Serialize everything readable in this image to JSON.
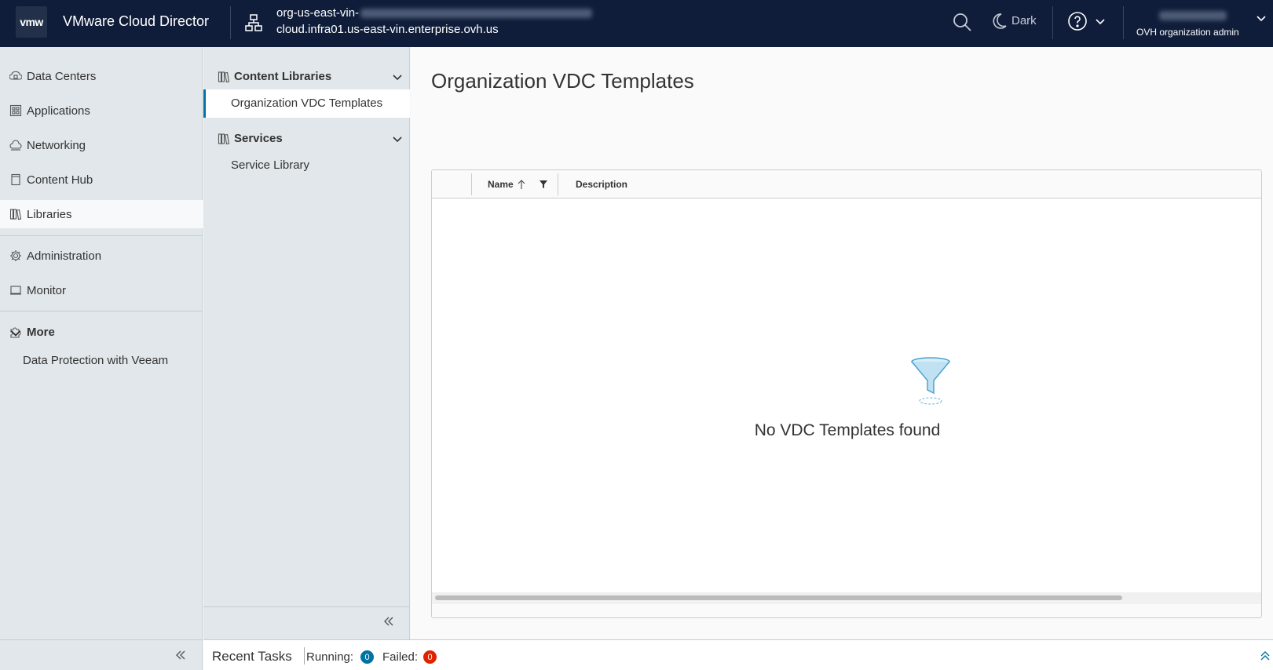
{
  "header": {
    "logo_text": "vmw",
    "app_title": "VMware Cloud Director",
    "org_line1": "org-us-east-vin-",
    "org_line2": "cloud.infra01.us-east-vin.enterprise.ovh.us",
    "theme_label": "Dark",
    "user_role": "OVH organization admin"
  },
  "leftnav": {
    "items": [
      {
        "label": "Data Centers",
        "icon": "datacenter-icon"
      },
      {
        "label": "Applications",
        "icon": "applications-icon"
      },
      {
        "label": "Networking",
        "icon": "cloud-icon"
      },
      {
        "label": "Content Hub",
        "icon": "content-hub-icon"
      },
      {
        "label": "Libraries",
        "icon": "libraries-icon",
        "active": true
      },
      {
        "label": "Administration",
        "icon": "gear-icon"
      },
      {
        "label": "Monitor",
        "icon": "monitor-icon"
      }
    ],
    "more_label": "More",
    "more_sub": "Data Protection with Veeam"
  },
  "subnav": {
    "group1": "Content Libraries",
    "group1_item": "Organization VDC Templates",
    "group2": "Services",
    "group2_item": "Service Library"
  },
  "main": {
    "title": "Organization VDC Templates",
    "columns": {
      "name": "Name",
      "description": "Description"
    },
    "empty_text": "No VDC Templates found"
  },
  "tasks": {
    "label": "Recent Tasks",
    "running_label": "Running:",
    "running_count": "0",
    "failed_label": "Failed:",
    "failed_count": "0"
  },
  "colors": {
    "header_bg": "#0f1d3a",
    "nav_bg": "#e1e7eb",
    "accent": "#0072a3",
    "failed": "#e02200"
  }
}
